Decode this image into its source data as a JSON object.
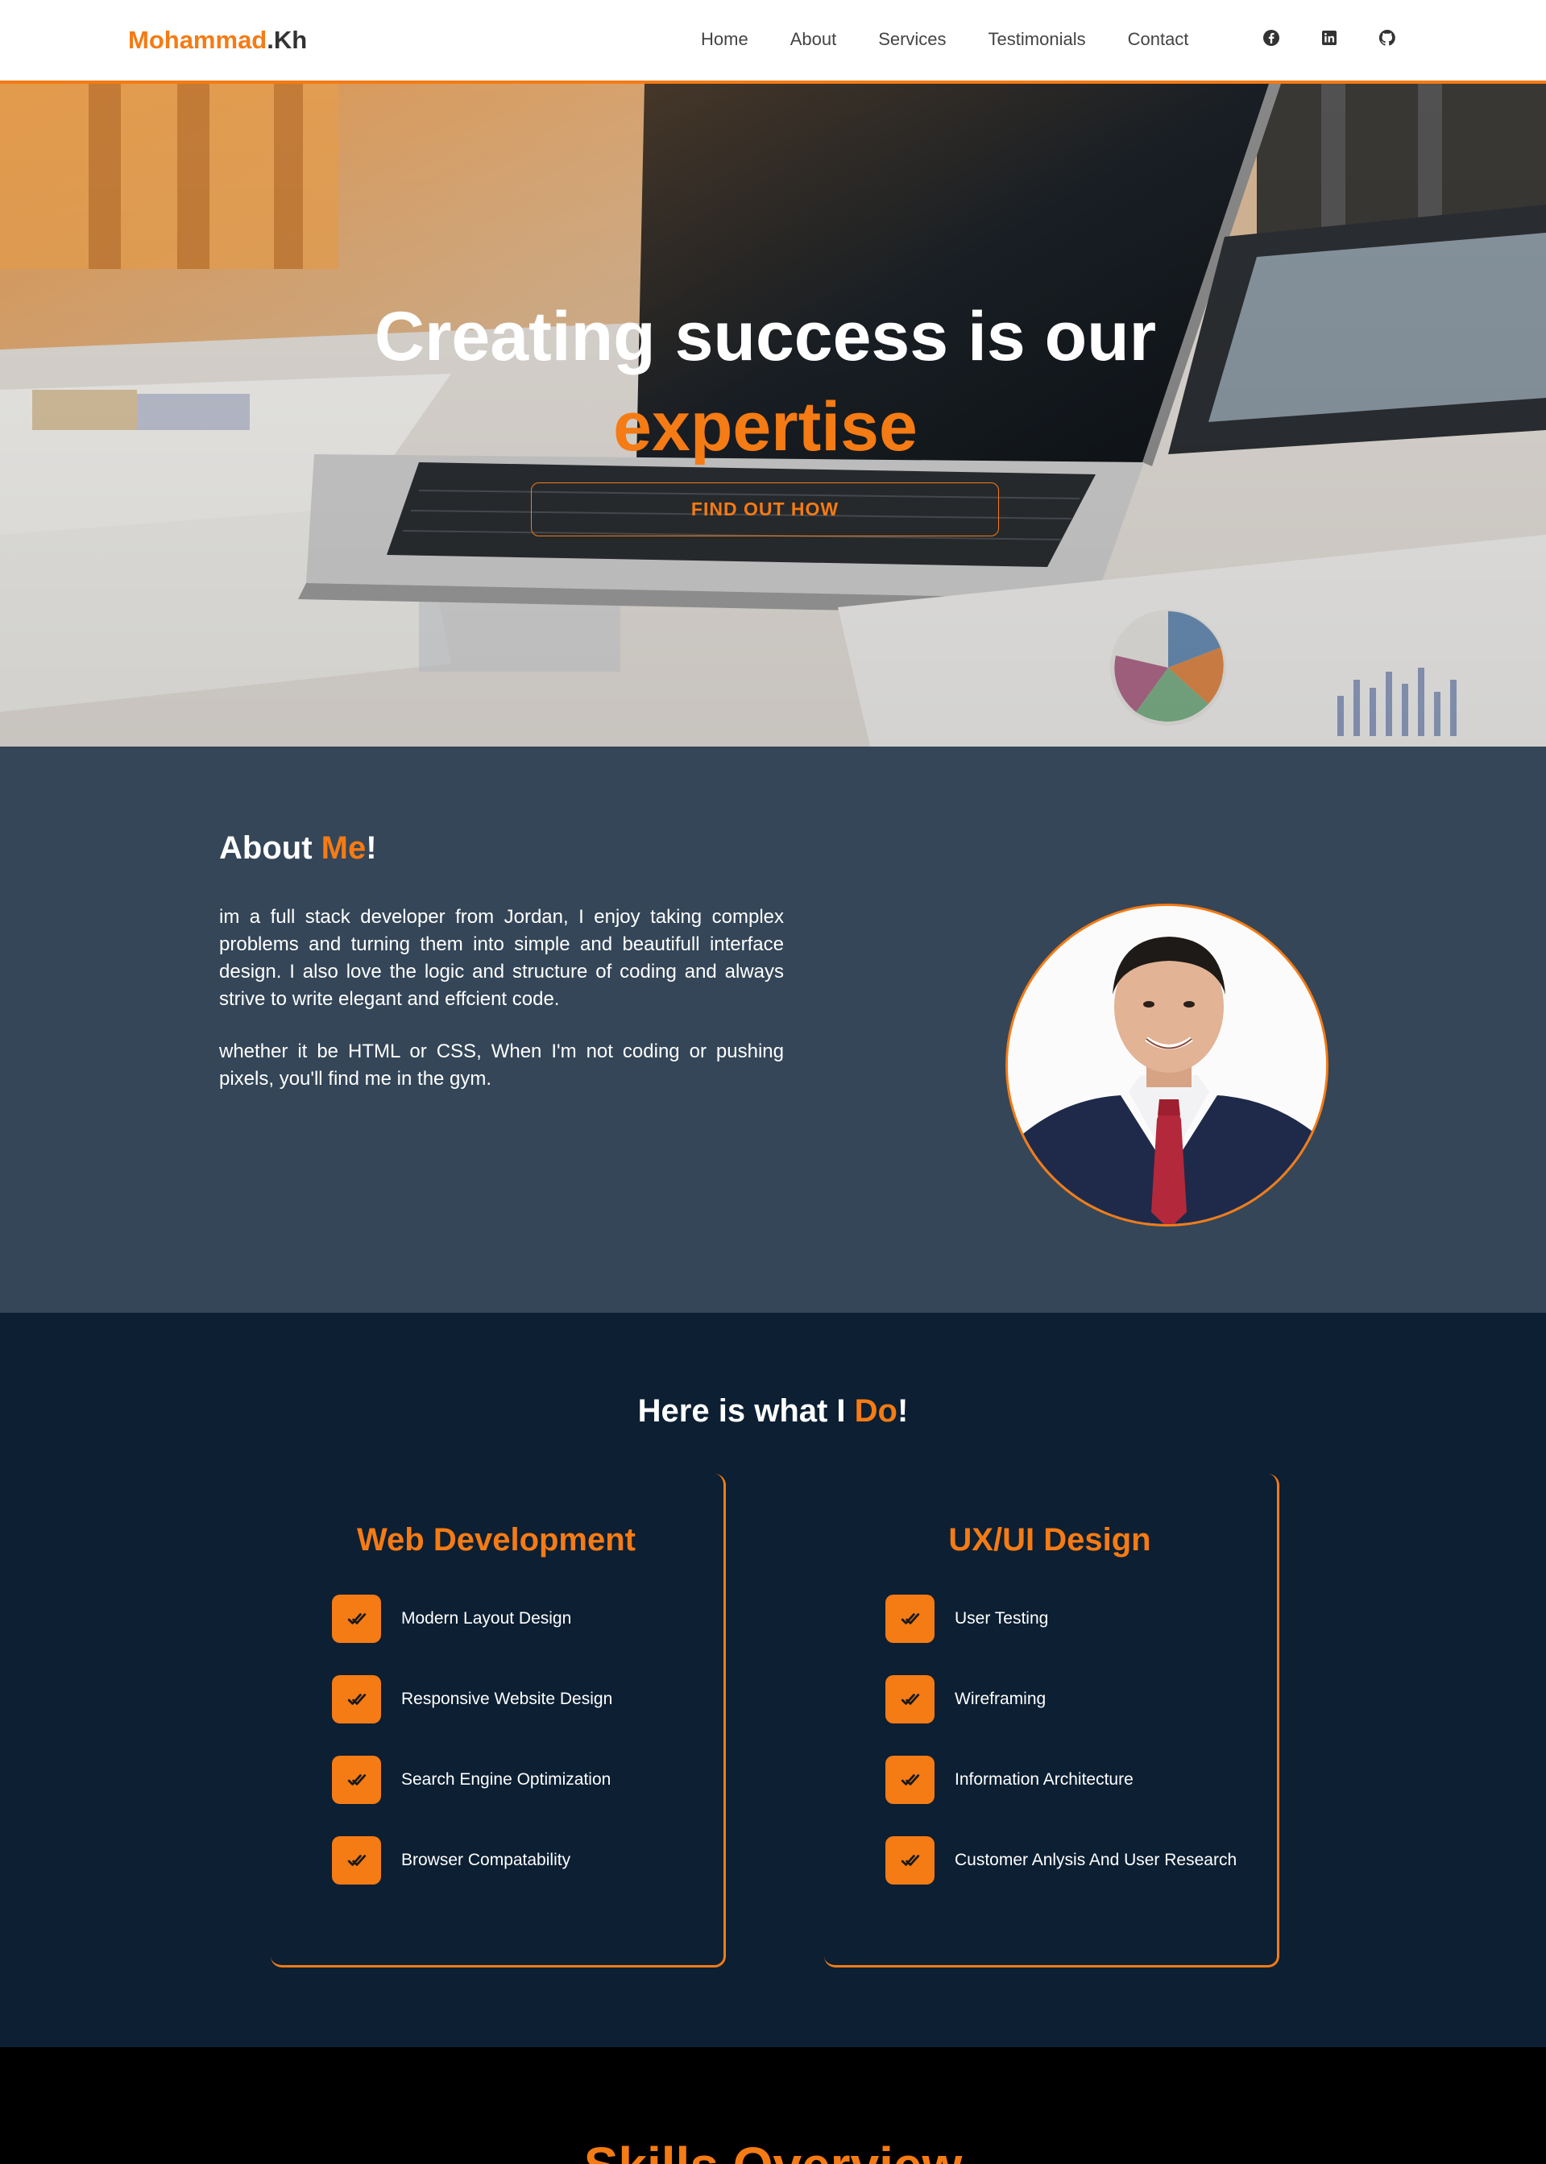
{
  "nav": {
    "brand_first": "Mohammad",
    "brand_second": ".Kh",
    "links": [
      "Home",
      "About",
      "Services",
      "Testimonials",
      "Contact"
    ],
    "social_icons": [
      "facebook-icon",
      "linkedin-icon",
      "github-icon"
    ]
  },
  "hero": {
    "title_line1": "Creating success is our",
    "title_line2": "expertise",
    "cta": "FIND OUT HOW"
  },
  "about": {
    "heading_a": "About ",
    "heading_b": "Me",
    "heading_c": "!",
    "para1": "im a full stack developer from Jordan, I enjoy taking complex problems and turning them into simple and beautifull interface design. I also love the logic and structure of coding and always strive to write elegant and effcient code.",
    "para2": "whether it be HTML or CSS, When I'm not coding or pushing pixels, you'll find me in the gym."
  },
  "services": {
    "heading_a": "Here is what I ",
    "heading_b": "Do",
    "heading_c": "!",
    "cards": [
      {
        "title": "Web Development",
        "items": [
          "Modern Layout Design",
          "Responsive Website Design",
          "Search Engine Optimization",
          "Browser Compatability"
        ]
      },
      {
        "title": "UX/UI Design",
        "items": [
          "User Testing",
          "Wireframing",
          "Information Architecture",
          "Customer Anlysis And User Research"
        ]
      }
    ]
  },
  "skills": {
    "heading": "Skills Overview"
  },
  "colors": {
    "accent": "#f57b14",
    "about_bg": "#344658",
    "services_bg": "#0c1f33",
    "skills_bg": "#000000"
  }
}
